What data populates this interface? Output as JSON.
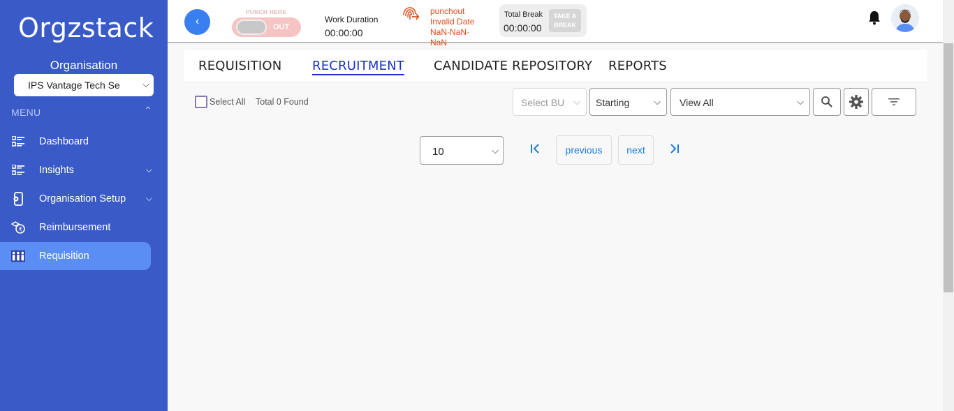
{
  "brand": {
    "logo_text": "Orgzstack"
  },
  "sidebar": {
    "org_label": "Organisation",
    "org_select_value": "IPS Vantage Tech Se",
    "menu_label": "MENU",
    "items": [
      {
        "label": "Dashboard",
        "icon": "dashboard-list-icon",
        "expandable": false
      },
      {
        "label": "Insights",
        "icon": "insights-list-icon",
        "expandable": true
      },
      {
        "label": "Organisation Setup",
        "icon": "organisation-setup-icon",
        "expandable": true
      },
      {
        "label": "Reimbursement",
        "icon": "reimbursement-icon",
        "expandable": false
      },
      {
        "label": "Requisition",
        "icon": "requisition-people-icon",
        "expandable": false,
        "active": true
      }
    ]
  },
  "topbar": {
    "back_icon": "‹",
    "punch_here_label": "PUNCH HERE",
    "punch_state": "OUT",
    "work_duration_label": "Work Duration",
    "work_duration_value": "00:00:00",
    "punch_info": {
      "line1": "punchout",
      "line2": "Invalid Date",
      "line3": "NaN-NaN-NaN"
    },
    "total_break_label": "Total Break",
    "total_break_value": "00:00:00",
    "take_break_label": "TAKE A BREAK"
  },
  "tabs": [
    {
      "label": "REQUISITION",
      "active": false
    },
    {
      "label": "RECRUITMENT",
      "active": true
    },
    {
      "label": "CANDIDATE REPOSITORY",
      "active": false
    },
    {
      "label": "REPORTS",
      "active": false
    }
  ],
  "filters": {
    "select_all_label": "Select All",
    "total_found": "Total 0 Found",
    "bu_placeholder": "Select BU",
    "starting_value": "Starting",
    "view_value": "View All"
  },
  "pagination": {
    "page_size": "10",
    "previous_label": "previous",
    "next_label": "next"
  },
  "colors": {
    "sidebar_bg": "#3a5bc7",
    "active_nav_bg": "#5b8ef5",
    "active_tab": "#1a2fd0",
    "punch_info": "#e04b1b",
    "link_blue": "#1a7ae8"
  }
}
